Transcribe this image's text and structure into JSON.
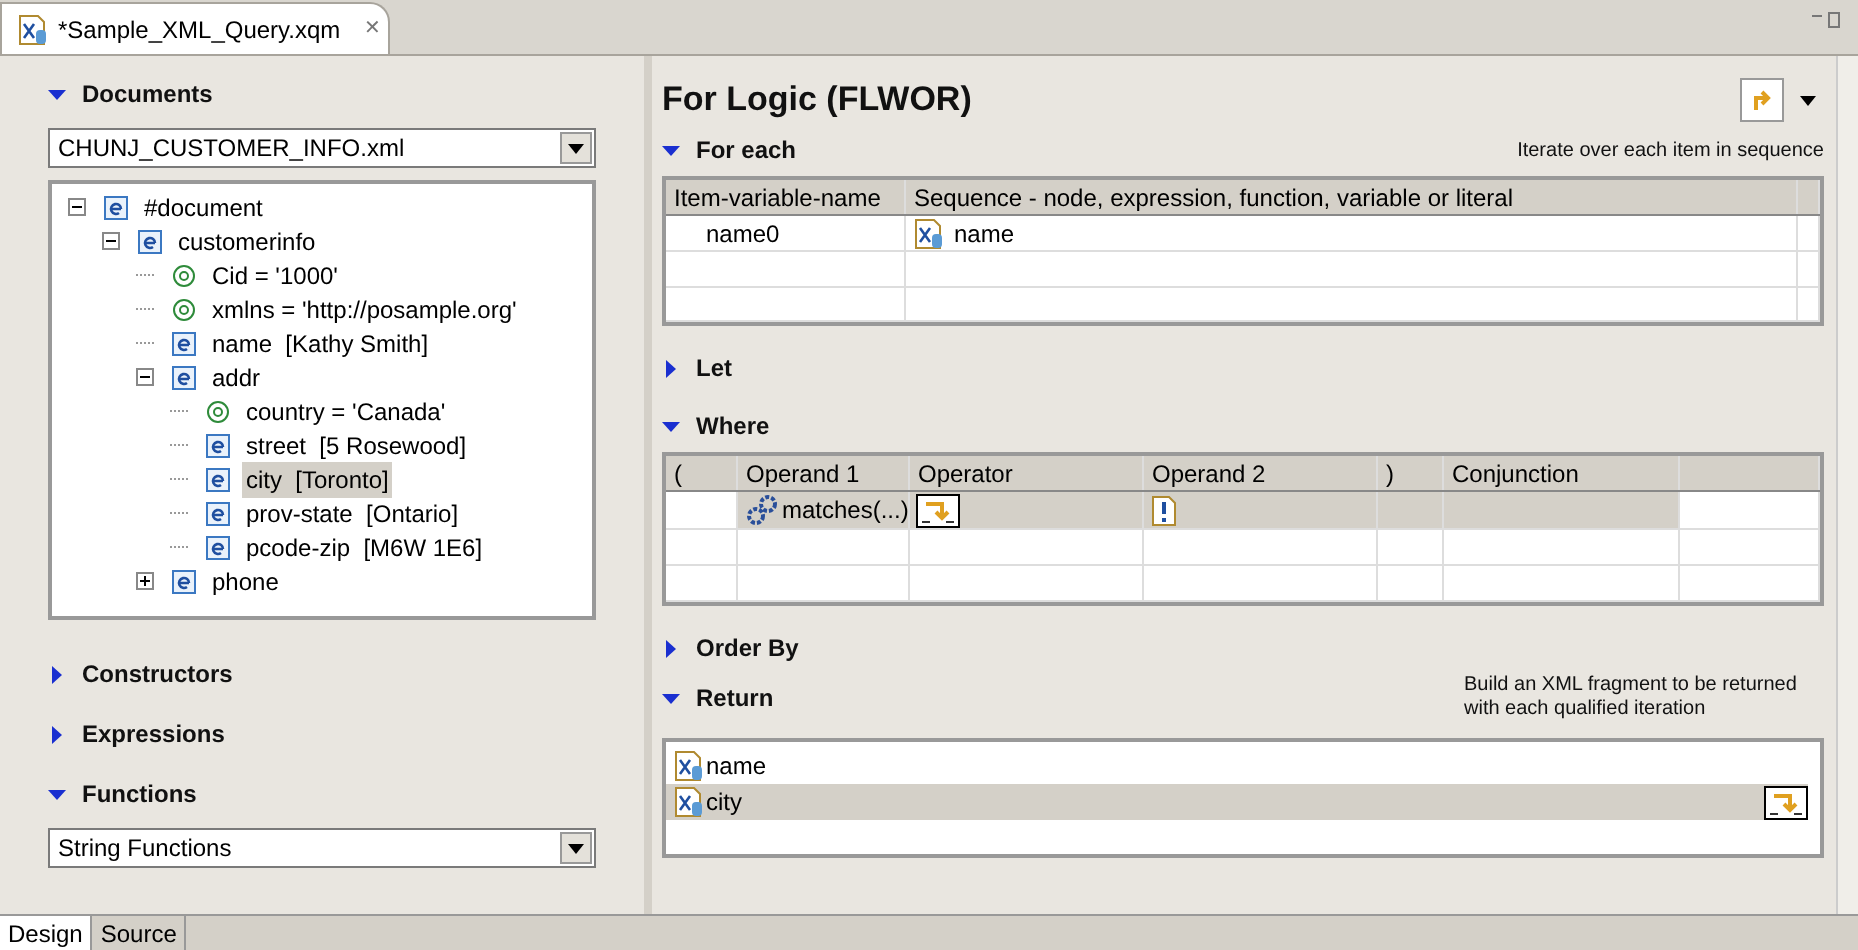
{
  "editor_tab": {
    "title": "*Sample_XML_Query.xqm",
    "close": "✕"
  },
  "left": {
    "documents": {
      "label": "Documents",
      "expanded": true,
      "select_value": "CHUNJ_CUSTOMER_INFO.xml",
      "tree": [
        {
          "kind": "element",
          "label": "#document",
          "expanded": true,
          "selected": false,
          "children": [
            {
              "kind": "element",
              "label": "customerinfo",
              "expanded": true,
              "selected": false,
              "children": [
                {
                  "kind": "attribute",
                  "label": "Cid = '1000'",
                  "selected": false
                },
                {
                  "kind": "attribute",
                  "label": "xmlns = 'http://posample.org'",
                  "selected": false
                },
                {
                  "kind": "element",
                  "label": "name  [Kathy Smith]",
                  "selected": false
                },
                {
                  "kind": "element",
                  "label": "addr",
                  "expanded": true,
                  "selected": false,
                  "children": [
                    {
                      "kind": "attribute",
                      "label": "country = 'Canada'",
                      "selected": false
                    },
                    {
                      "kind": "element",
                      "label": "street  [5 Rosewood]",
                      "selected": false
                    },
                    {
                      "kind": "element",
                      "label": "city  [Toronto]",
                      "selected": true
                    },
                    {
                      "kind": "element",
                      "label": "prov-state  [Ontario]",
                      "selected": false
                    },
                    {
                      "kind": "element",
                      "label": "pcode-zip  [M6W 1E6]",
                      "selected": false
                    }
                  ]
                },
                {
                  "kind": "element",
                  "label": "phone",
                  "expanded": false,
                  "selected": false
                }
              ]
            }
          ]
        }
      ]
    },
    "sections": [
      {
        "label": "Constructors",
        "expanded": false
      },
      {
        "label": "Expressions",
        "expanded": false
      },
      {
        "label": "Functions",
        "expanded": true,
        "select_value": "String Functions"
      }
    ]
  },
  "right": {
    "title": "For Logic (FLWOR)",
    "for_each": {
      "label": "For each",
      "expanded": true,
      "note": "Iterate over each item in sequence",
      "columns": [
        "Item-variable-name",
        "Sequence - node, expression, function, variable or literal"
      ],
      "rows": [
        [
          "name0",
          "name"
        ]
      ]
    },
    "let": {
      "label": "Let",
      "expanded": false
    },
    "where": {
      "label": "Where",
      "expanded": true,
      "columns": [
        "(",
        "Operand 1",
        "Operator",
        "Operand 2",
        ")",
        "Conjunction"
      ],
      "rows": [
        {
          "operand1": "matches(...)",
          "selected": true
        }
      ]
    },
    "order_by": {
      "label": "Order By",
      "expanded": false
    },
    "return": {
      "label": "Return",
      "expanded": true,
      "note": "Build an XML  fragment to be returned with each qualified iteration",
      "rows": [
        {
          "label": "name",
          "selected": false
        },
        {
          "label": "city",
          "selected": true
        }
      ]
    }
  },
  "bottom_tabs": [
    {
      "label": "Design",
      "selected": true
    },
    {
      "label": "Source",
      "selected": false
    }
  ]
}
